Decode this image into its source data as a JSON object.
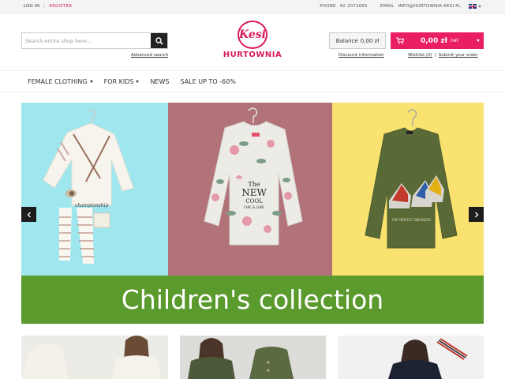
{
  "topbar": {
    "login": "LOG IN",
    "register": "REGISTER",
    "phone_label": "PHONE",
    "phone": "42 2072665",
    "email_label": "EMAIL",
    "email": "INFO@HURTOWNIA-KESI.PL"
  },
  "search": {
    "placeholder": "Search entire shop here...",
    "value": "",
    "advanced": "Advanced search"
  },
  "logo": {
    "script": "Kesi",
    "word": "HURTOWNIA"
  },
  "account": {
    "balance_label": "Balance",
    "balance_value": "0,00 zł",
    "cart_amount": "0,00 zł",
    "cart_suffix": "net",
    "discount": "Discount information",
    "wishlist": "Wishlist (0)",
    "separator": "|",
    "submit_order": "Submit your order"
  },
  "nav": {
    "items": [
      {
        "label": "FEMALE CLOTHING",
        "dropdown": true
      },
      {
        "label": "FOR KIDS",
        "dropdown": true
      },
      {
        "label": "NEWS",
        "dropdown": false
      },
      {
        "label": "SALE UP TO -60%",
        "dropdown": false
      }
    ]
  },
  "slider": {
    "banner": "Children's collection",
    "shirt_text_1": "The",
    "shirt_text_2": "NEW",
    "shirt_text_3": "COOL",
    "shirt_text_4": "CHIC & LUXE"
  },
  "colors": {
    "accent": "#e91e63",
    "banner_green": "#5b9a2c",
    "panel_blue": "#9fe6ef",
    "panel_rose": "#b1727a",
    "panel_yellow": "#f9e270"
  }
}
